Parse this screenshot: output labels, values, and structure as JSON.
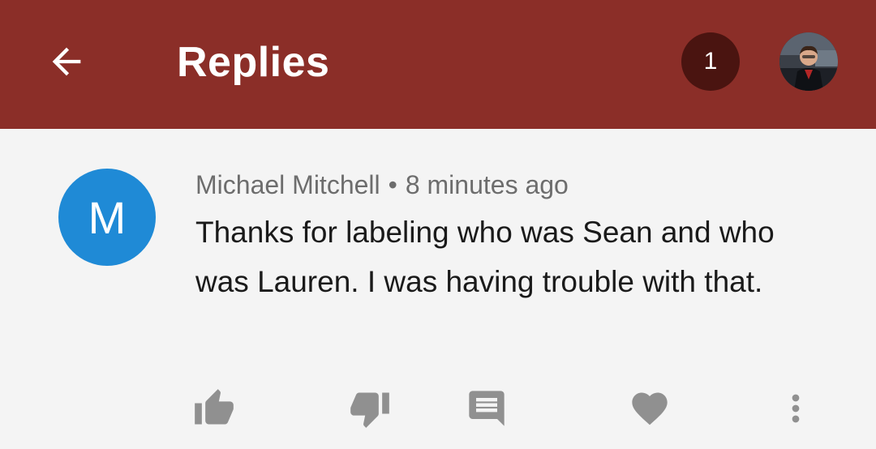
{
  "header": {
    "title": "Replies",
    "notification_count": "1",
    "back_icon": "arrow-left-icon",
    "account_avatar": "account-avatar-photo"
  },
  "comment": {
    "avatar_letter": "M",
    "avatar_color": "#1f8ad6",
    "author": "Michael Mitchell",
    "separator": "•",
    "time": "8 minutes ago",
    "text": "Thanks for labeling who was Sean and who was Lauren. I was having trouble with that."
  },
  "actions": {
    "icons": [
      "thumbs-up-icon",
      "thumbs-down-icon",
      "reply-icon",
      "heart-icon",
      "more-vert-icon"
    ]
  },
  "colors": {
    "appbar": "#8b2e28",
    "badge": "#4a1410",
    "background": "#f4f4f4",
    "icon_gray": "#909090"
  }
}
